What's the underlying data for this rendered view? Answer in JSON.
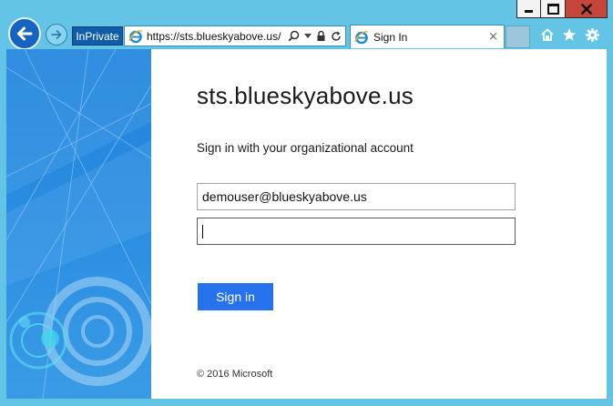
{
  "browser": {
    "inprivate_label": "InPrivate",
    "address_url": "https://sts.blueskyabove.us/",
    "tab_title": "Sign In",
    "tab_close_glyph": "×",
    "icons": [
      "back-icon",
      "forward-icon",
      "ie-logo-icon",
      "search-icon",
      "dropdown-icon",
      "lock-icon",
      "refresh-icon",
      "home-icon",
      "favorites-icon",
      "settings-icon"
    ]
  },
  "window": {
    "minimize": "minimize",
    "maximize": "maximize",
    "close": "close"
  },
  "page": {
    "site_title": "sts.blueskyabove.us",
    "intro": "Sign in with your organizational account",
    "username_value": "demouser@blueskyabove.us",
    "password_value": "",
    "signin_label": "Sign in",
    "footer": "© 2016 Microsoft"
  },
  "colors": {
    "accent": "#2672ec",
    "frame": "#64c4e6",
    "illustration": "#2d8fe2",
    "close_button": "#c7463c"
  }
}
